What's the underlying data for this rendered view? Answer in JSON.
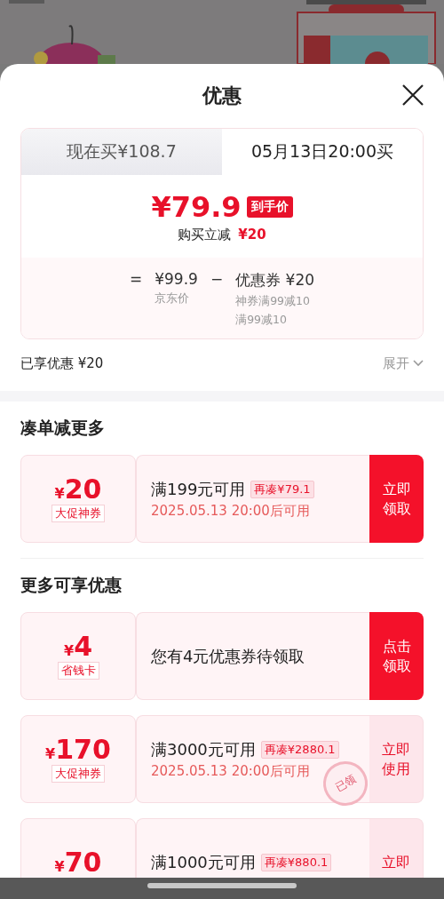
{
  "sheet": {
    "title": "优惠"
  },
  "price_card": {
    "tabs": [
      {
        "label": "现在买¥108.7",
        "selected": false
      },
      {
        "label": "05月13日20:00买",
        "selected": true
      }
    ],
    "final_price": "¥79.9",
    "final_badge": "到手价",
    "instant_label": "购买立减",
    "instant_amount": "¥20",
    "formula": {
      "equals": "=",
      "base_price": "¥99.9",
      "base_label": "京东价",
      "minus": "−",
      "discount": "优惠券 ¥20",
      "discount_notes": [
        "神券满99减10",
        "满99减10"
      ]
    }
  },
  "summary": {
    "label": "已享优惠 ¥20",
    "expand": "展开"
  },
  "sections": [
    {
      "title": "凑单减更多",
      "coupons": [
        {
          "currency": "¥",
          "amount": "20",
          "tag": "大促神券",
          "title": "满199元可用",
          "extra": "再凑¥79.1",
          "date": "2025.05.13 20:00后可用",
          "button": "立即领取",
          "kind": "solid"
        }
      ]
    },
    {
      "title": "更多可享优惠",
      "coupons": [
        {
          "currency": "¥",
          "amount": "4",
          "tag": "省钱卡",
          "title": "您有4元优惠券待领取",
          "button": "点击领取",
          "kind": "solid"
        },
        {
          "currency": "¥",
          "amount": "170",
          "tag": "大促神券",
          "title": "满3000元可用",
          "extra": "再凑¥2880.1",
          "date": "2025.05.13 20:00后可用",
          "button": "立即使用",
          "kind": "soft",
          "stamp": "已领"
        },
        {
          "currency": "¥",
          "amount": "70",
          "title": "满1000元可用",
          "extra": "再凑¥880.1",
          "button": "立即",
          "kind": "soft"
        }
      ]
    }
  ]
}
